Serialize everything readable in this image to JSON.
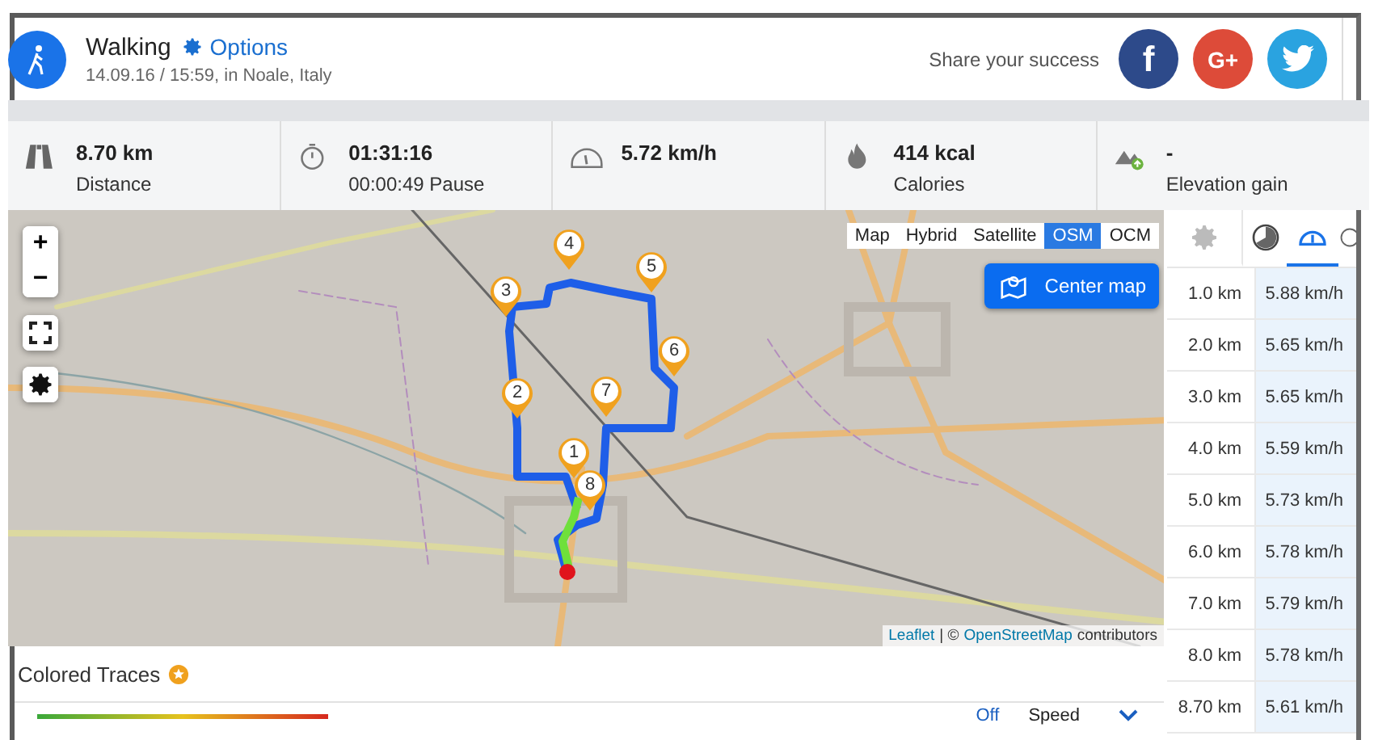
{
  "activity": {
    "title": "Walking",
    "options": "Options",
    "subtitle": "14.09.16 / 15:59, in Noale, Italy"
  },
  "share": {
    "label": "Share your success",
    "buttons": [
      {
        "kind": "facebook",
        "label": "f"
      },
      {
        "kind": "google",
        "label": "G+"
      },
      {
        "kind": "twitter"
      }
    ]
  },
  "stats": [
    {
      "kind": "distance",
      "value": "8.70 km",
      "label": "Distance"
    },
    {
      "kind": "duration",
      "value": "01:31:16",
      "label": "00:00:49 Pause"
    },
    {
      "kind": "speed",
      "value": "5.72 km/h"
    },
    {
      "kind": "calories",
      "value": "414 kcal",
      "label": "Calories"
    },
    {
      "kind": "elevation",
      "value": "-",
      "label": "Elevation gain"
    }
  ],
  "map": {
    "layers": [
      {
        "label": "Map",
        "selected": false
      },
      {
        "label": "Hybrid",
        "selected": false
      },
      {
        "label": "Satellite",
        "selected": false
      },
      {
        "label": "OSM",
        "selected": true
      },
      {
        "label": "OCM",
        "selected": false
      }
    ],
    "center_button": "Center map",
    "zoom_in": "+",
    "zoom_out": "−",
    "markers": [
      "1",
      "2",
      "3",
      "4",
      "5",
      "6",
      "7",
      "8"
    ],
    "attribution": {
      "leaflet": "Leaflet",
      "separator": "| ©",
      "osm": "OpenStreetMap",
      "suffix": "contributors"
    }
  },
  "splits": {
    "tabs": [
      {
        "kind": "settings",
        "selected": false
      },
      {
        "kind": "pace",
        "selected": false
      },
      {
        "kind": "speed",
        "selected": true
      },
      {
        "kind": "time",
        "selected": false
      }
    ],
    "rows": [
      {
        "distance": "1.0 km",
        "speed": "5.88 km/h"
      },
      {
        "distance": "2.0 km",
        "speed": "5.65 km/h"
      },
      {
        "distance": "3.0 km",
        "speed": "5.65 km/h"
      },
      {
        "distance": "4.0 km",
        "speed": "5.59 km/h"
      },
      {
        "distance": "5.0 km",
        "speed": "5.73 km/h"
      },
      {
        "distance": "6.0 km",
        "speed": "5.78 km/h"
      },
      {
        "distance": "7.0 km",
        "speed": "5.79 km/h"
      },
      {
        "distance": "8.0 km",
        "speed": "5.78 km/h"
      },
      {
        "distance": "8.70 km",
        "speed": "5.61 km/h"
      }
    ]
  },
  "traces": {
    "title": "Colored Traces",
    "off": "Off",
    "mode": "Speed"
  }
}
